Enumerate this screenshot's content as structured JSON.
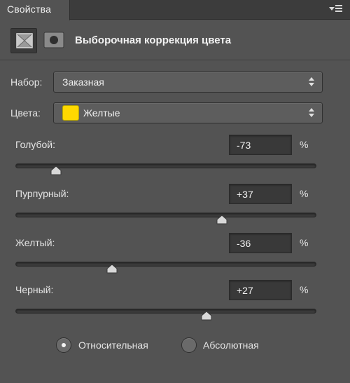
{
  "panel": {
    "tab_label": "Свойства",
    "menu_icon": "panel-menu-icon"
  },
  "header": {
    "title": "Выборочная коррекция цвета",
    "mask_icon": "layer-mask-icon",
    "adjustment_icon": "adjustment-layer-icon"
  },
  "preset": {
    "label": "Набор:",
    "value": "Заказная"
  },
  "colors": {
    "label": "Цвета:",
    "value": "Желтые",
    "swatch_color": "#ffd800"
  },
  "sliders": [
    {
      "label": "Голубой:",
      "value": "-73",
      "unit": "%",
      "amount": -73
    },
    {
      "label": "Пурпурный:",
      "value": "+37",
      "unit": "%",
      "amount": 37
    },
    {
      "label": "Желтый:",
      "value": "-36",
      "unit": "%",
      "amount": -36
    },
    {
      "label": "Черный:",
      "value": "+27",
      "unit": "%",
      "amount": 27
    }
  ],
  "method": {
    "options": [
      {
        "label": "Относительная",
        "selected": true
      },
      {
        "label": "Абсолютная",
        "selected": false
      }
    ]
  },
  "colors_theme": {
    "panel_bg": "#535353",
    "field_bg": "#393939",
    "text": "#e6e6e6"
  }
}
